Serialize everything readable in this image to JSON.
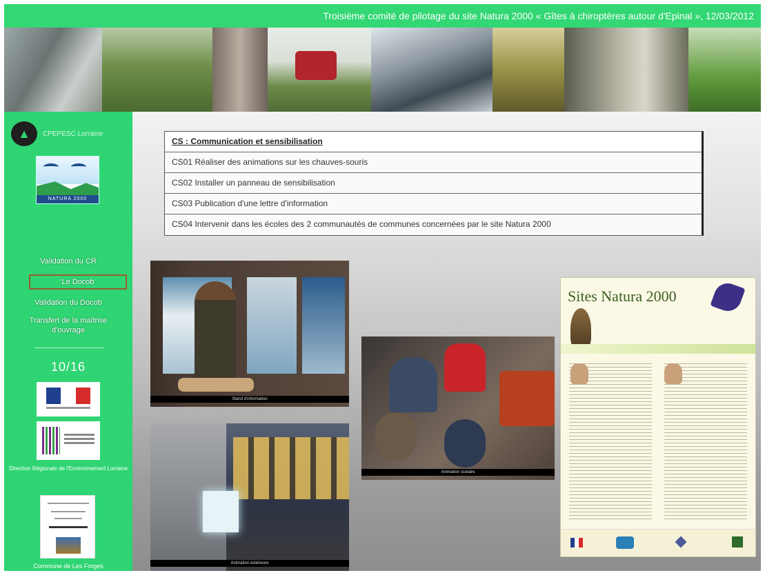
{
  "header": {
    "title": "Troisième comité de pilotage du site Natura 2000 « Gîtes à chiroptères autour d'Epinal », 12/03/2012"
  },
  "sidebar": {
    "org_label": "CPEPESC Lorraine",
    "natura_caption": "NATURA 2000",
    "nav_items": [
      {
        "label": "Validation du CR"
      },
      {
        "label": "Le Docob"
      },
      {
        "label": "Validation du Docob"
      },
      {
        "label": "Transfert de la maîtrise d'ouvrage"
      }
    ],
    "page_counter": "10/16",
    "dreal_caption": "Direction Régionale de l'Environnement Lorraine",
    "commune_caption": "Commune de Les Forges"
  },
  "cs_table": {
    "header": "CS : Communication et sensibilisation",
    "rows": [
      "CS01 Réaliser des animations sur les chauves-souris",
      "CS02 Installer un panneau de sensibilisation",
      "CS03 Publication d'une lettre d'information",
      "CS04 Intervenir dans les écoles des 2 communautés de communes concernées par le site Natura 2000"
    ]
  },
  "photos": {
    "photo1_caption": "Stand d'information",
    "photo2_caption": "Animation extérieure",
    "photo3_caption": "Animation scolaire"
  },
  "newsletter": {
    "title": "Sites Natura 2000"
  }
}
